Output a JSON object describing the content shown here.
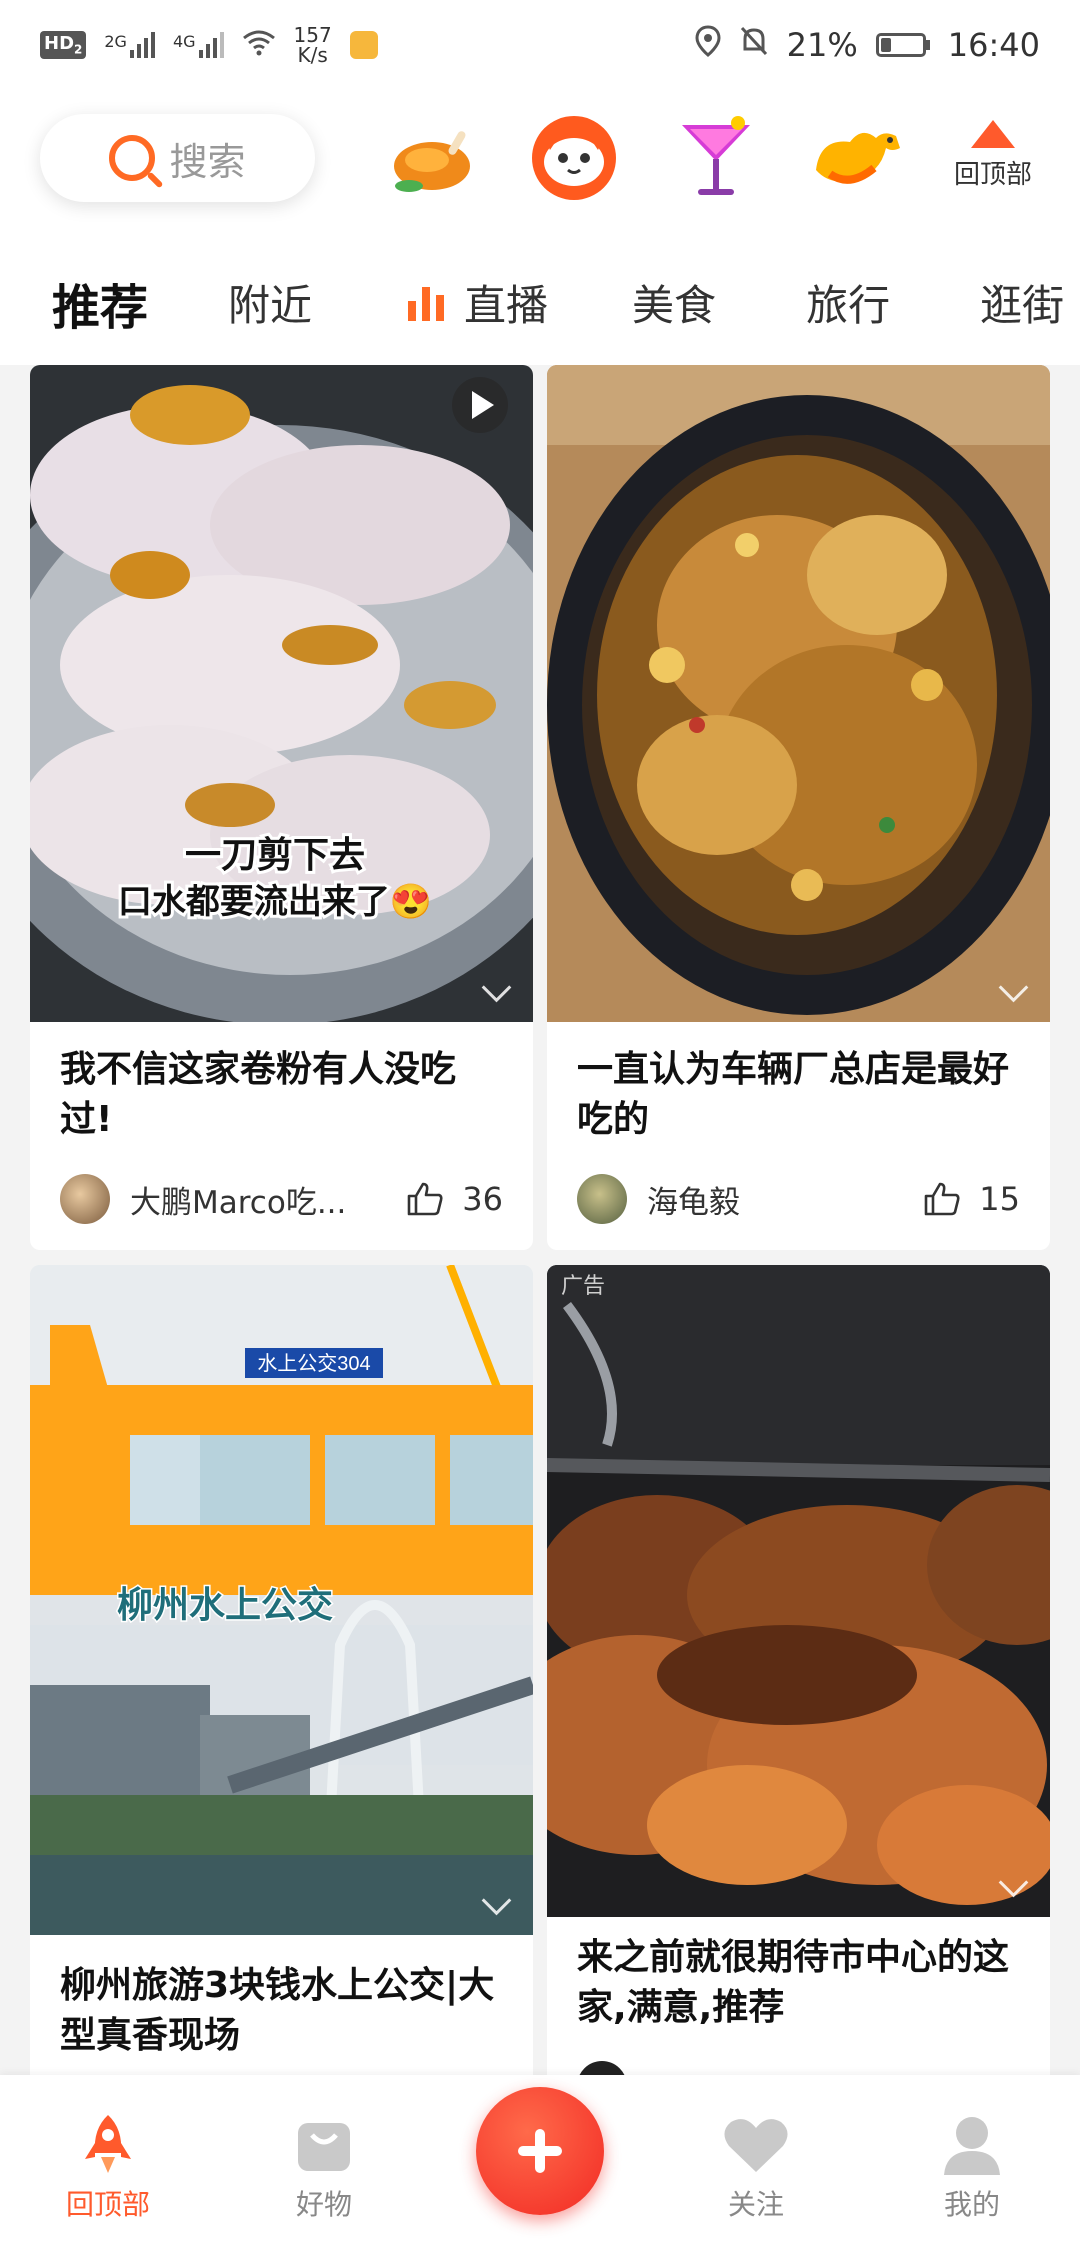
{
  "status_bar": {
    "network_left": "HD",
    "network_sub": "2",
    "signal1": "2G",
    "signal2": "4G",
    "speed_value": "157",
    "speed_unit": "K/s",
    "battery": "21%",
    "time": "16:40"
  },
  "header": {
    "search_placeholder": "搜索",
    "back_to_top_label": "回顶部"
  },
  "tabs": [
    "推荐",
    "附近",
    "直播",
    "美食",
    "旅行",
    "逛街"
  ],
  "feed": [
    {
      "title": "我不信这家卷粉有人没吃过!",
      "image_caption_line1": "一刀剪下去",
      "image_caption_line2": "口水都要流出来了😍",
      "author": "大鹏Marco吃...",
      "likes": "36",
      "has_video": true
    },
    {
      "title": "一直认为车辆厂总店是最好吃的",
      "author": "海龟毅",
      "likes": "15"
    },
    {
      "title": "柳州旅游3块钱水上公交|大型真香现场",
      "image_sign": "水上公交304",
      "image_caption": "柳州水上公交"
    },
    {
      "title": "来之前就很期待市中心的这家,满意,推荐",
      "ad_tag": "广告"
    }
  ],
  "bottom_nav": {
    "items": [
      {
        "label": "回顶部",
        "icon": "rocket-icon"
      },
      {
        "label": "好物",
        "icon": "bag-icon"
      },
      {
        "label": "关注",
        "icon": "heart-icon"
      },
      {
        "label": "我的",
        "icon": "user-icon"
      }
    ],
    "fab_icon": "plus-icon"
  },
  "colors": {
    "accent": "#ff5a2c",
    "fab": "#f22a24"
  }
}
